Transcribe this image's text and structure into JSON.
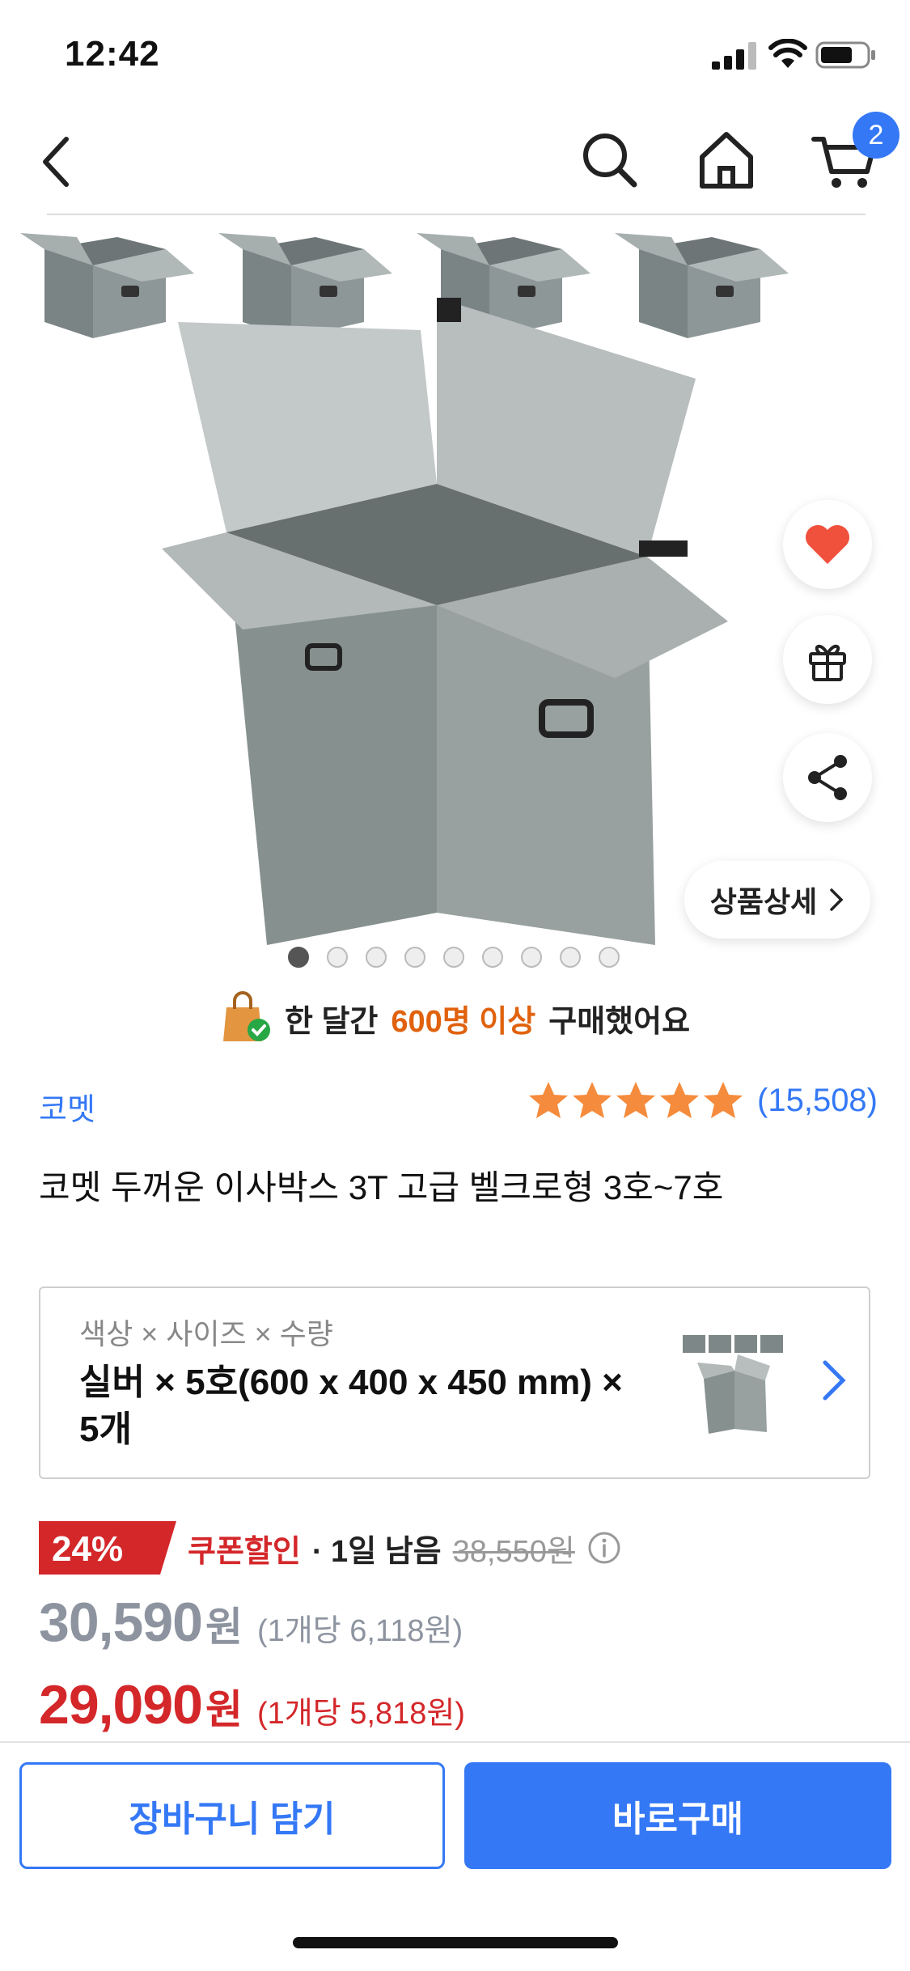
{
  "status_bar": {
    "time": "12:42"
  },
  "nav": {
    "cart_count": "2"
  },
  "gallery": {
    "detail_button_label": "상품상세",
    "dot_count": 9,
    "active_dot_index": 0
  },
  "purchase_info": {
    "prefix": "한 달간",
    "highlight": "600명 이상",
    "suffix": "구매했어요"
  },
  "product": {
    "brand": "코멧",
    "rating_count": "(15,508)",
    "stars": 5,
    "title": "코멧 두꺼운 이사박스 3T 고급 벨크로형 3호~7호"
  },
  "option": {
    "label": "색상 × 사이즈 × 수량",
    "value": "실버 × 5호(600 x 400 x 450 mm) × 5개"
  },
  "pricing": {
    "discount_pct": "24%",
    "coupon_label": "쿠폰할인",
    "remaining": "· 1일 남음",
    "original_price": "38,550원",
    "regular_price": "30,590",
    "regular_unit": "원",
    "regular_per_unit": "(1개당 6,118원)",
    "coupon_price": "29,090",
    "coupon_unit": "원",
    "coupon_per_unit": "(1개당 5,818원)"
  },
  "bottom_bar": {
    "add_to_cart": "장바구니 담기",
    "buy_now": "바로구매"
  },
  "colors": {
    "accent": "#3478f6",
    "sale": "#d4272a",
    "orange": "#e0620e",
    "star": "#f58b3c"
  }
}
